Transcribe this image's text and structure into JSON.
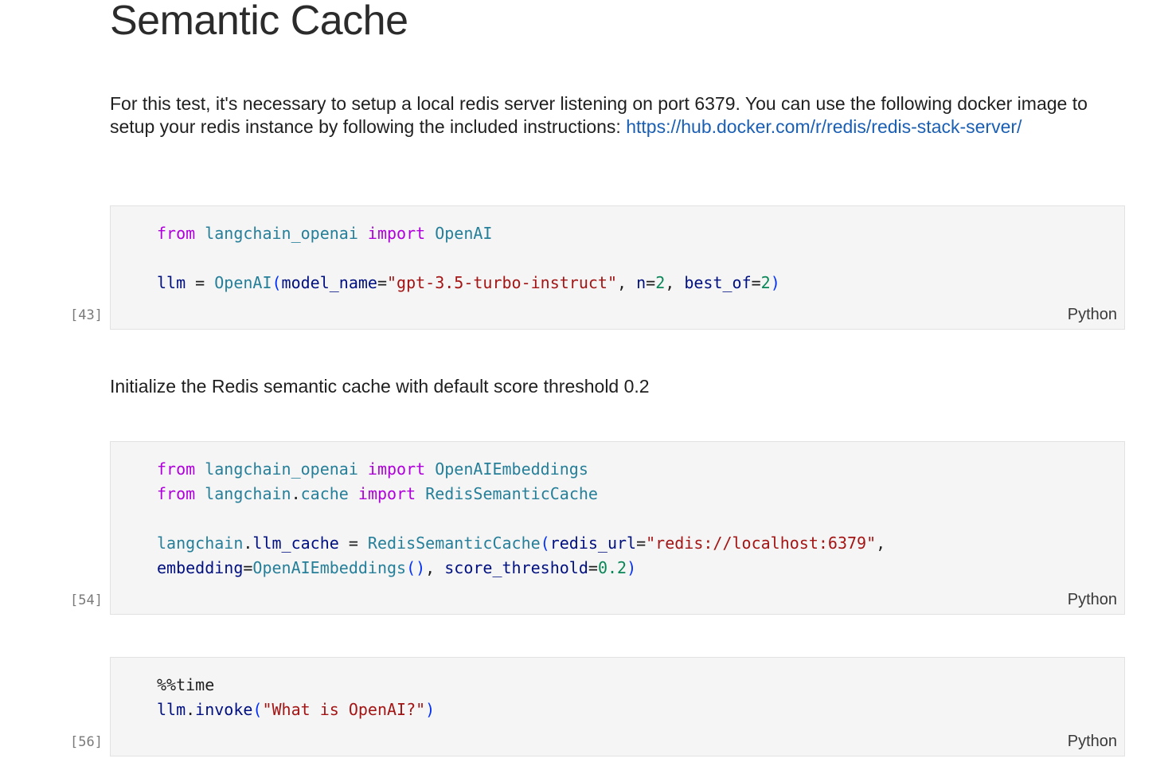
{
  "heading": "Semantic Cache",
  "intro": {
    "text": "For this test, it's necessary to setup a local redis server listening on port 6379. You can use the following docker image to setup your redis instance by following the included instructions: ",
    "link": "https://hub.docker.com/r/redis/redis-stack-server/"
  },
  "init_text": "Initialize the Redis semantic cache with default score threshold 0.2",
  "cells": [
    {
      "exec_count": "[43]",
      "language": "Python",
      "lines": [
        [
          [
            "kw",
            "from"
          ],
          [
            "txt",
            " "
          ],
          [
            "mod",
            "langchain_openai"
          ],
          [
            "txt",
            " "
          ],
          [
            "kw",
            "import"
          ],
          [
            "txt",
            " "
          ],
          [
            "cls",
            "OpenAI"
          ]
        ],
        [],
        [
          [
            "var",
            "llm"
          ],
          [
            "txt",
            " = "
          ],
          [
            "cls",
            "OpenAI"
          ],
          [
            "par",
            "("
          ],
          [
            "var",
            "model_name"
          ],
          [
            "txt",
            "="
          ],
          [
            "str",
            "\"gpt-3.5-turbo-instruct\""
          ],
          [
            "txt",
            ", "
          ],
          [
            "var",
            "n"
          ],
          [
            "txt",
            "="
          ],
          [
            "num",
            "2"
          ],
          [
            "txt",
            ", "
          ],
          [
            "var",
            "best_of"
          ],
          [
            "txt",
            "="
          ],
          [
            "num",
            "2"
          ],
          [
            "par",
            ")"
          ]
        ]
      ]
    },
    {
      "exec_count": "[54]",
      "language": "Python",
      "lines": [
        [
          [
            "kw",
            "from"
          ],
          [
            "txt",
            " "
          ],
          [
            "mod",
            "langchain_openai"
          ],
          [
            "txt",
            " "
          ],
          [
            "kw",
            "import"
          ],
          [
            "txt",
            " "
          ],
          [
            "cls",
            "OpenAIEmbeddings"
          ]
        ],
        [
          [
            "kw",
            "from"
          ],
          [
            "txt",
            " "
          ],
          [
            "mod",
            "langchain"
          ],
          [
            "txt",
            "."
          ],
          [
            "mod",
            "cache"
          ],
          [
            "txt",
            " "
          ],
          [
            "kw",
            "import"
          ],
          [
            "txt",
            " "
          ],
          [
            "cls",
            "RedisSemanticCache"
          ]
        ],
        [],
        [
          [
            "mod",
            "langchain"
          ],
          [
            "txt",
            "."
          ],
          [
            "var",
            "llm_cache"
          ],
          [
            "txt",
            " = "
          ],
          [
            "cls",
            "RedisSemanticCache"
          ],
          [
            "par",
            "("
          ],
          [
            "var",
            "redis_url"
          ],
          [
            "txt",
            "="
          ],
          [
            "str",
            "\"redis://localhost:6379\""
          ],
          [
            "txt",
            ","
          ]
        ],
        [
          [
            "var",
            "embedding"
          ],
          [
            "txt",
            "="
          ],
          [
            "cls",
            "OpenAIEmbeddings"
          ],
          [
            "par",
            "()"
          ],
          [
            "txt",
            ", "
          ],
          [
            "var",
            "score_threshold"
          ],
          [
            "txt",
            "="
          ],
          [
            "num",
            "0.2"
          ],
          [
            "par",
            ")"
          ]
        ]
      ]
    },
    {
      "exec_count": "[56]",
      "language": "Python",
      "lines": [
        [
          [
            "txt",
            "%%time"
          ]
        ],
        [
          [
            "var",
            "llm"
          ],
          [
            "txt",
            "."
          ],
          [
            "var",
            "invoke"
          ],
          [
            "par",
            "("
          ],
          [
            "str",
            "\"What is OpenAI?\""
          ],
          [
            "par",
            ")"
          ]
        ]
      ]
    }
  ]
}
